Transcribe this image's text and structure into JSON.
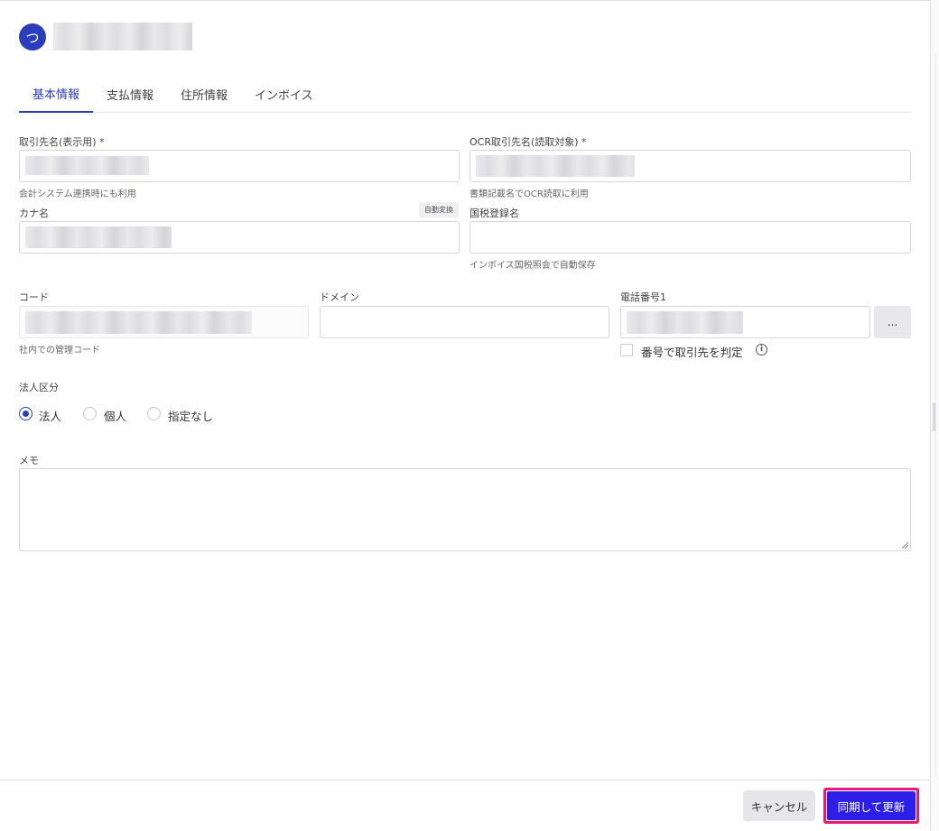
{
  "header": {
    "avatar_initial": "つ"
  },
  "tabs": [
    {
      "label": "基本情報",
      "active": true
    },
    {
      "label": "支払情報",
      "active": false
    },
    {
      "label": "住所情報",
      "active": false
    },
    {
      "label": "インボイス",
      "active": false
    }
  ],
  "form": {
    "display_name": {
      "label": "取引先名(表示用) *",
      "help": "会計システム連携時にも利用"
    },
    "ocr_name": {
      "label": "OCR取引先名(読取対象) *",
      "help": "書類記載名でOCR読取に利用"
    },
    "kana": {
      "label": "カナ名",
      "badge": "自動変換"
    },
    "tax_name": {
      "label": "国税登録名",
      "help": "インボイス国税照会で自動保存"
    },
    "code": {
      "label": "コード",
      "help": "社内での管理コード"
    },
    "domain": {
      "label": "ドメイン"
    },
    "phone": {
      "label": "電話番号1",
      "more_button": "...",
      "checkbox_label": "番号で取引先を判定",
      "info_icon": "info-icon"
    },
    "corp_type": {
      "label": "法人区分",
      "options": [
        {
          "label": "法人",
          "selected": true
        },
        {
          "label": "個人",
          "selected": false
        },
        {
          "label": "指定なし",
          "selected": false
        }
      ]
    },
    "memo": {
      "label": "メモ"
    }
  },
  "footer": {
    "cancel_label": "キャンセル",
    "submit_label": "同期して更新"
  },
  "colors": {
    "accent": "#2b3dbd",
    "primary_button": "#2d1ee8",
    "highlight_border": "#e8187a"
  }
}
